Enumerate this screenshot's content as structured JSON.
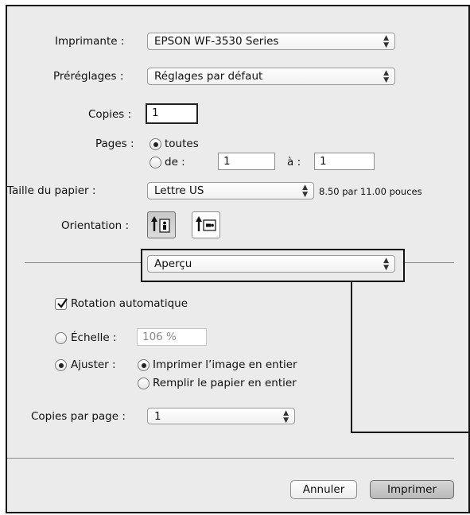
{
  "printer": {
    "label": "Imprimante :",
    "value": "EPSON WF-3530 Series"
  },
  "presets": {
    "label": "Préréglages :",
    "value": "Réglages par défaut"
  },
  "copies": {
    "label": "Copies :",
    "value": "1"
  },
  "pages": {
    "label": "Pages :",
    "all_label": "toutes",
    "from_label": "de :",
    "from_value": "1",
    "to_label": "à :",
    "to_value": "1"
  },
  "paper_size": {
    "label": "Taille du papier :",
    "value": "Lettre US",
    "dimensions": "8.50 par 11.00 pouces"
  },
  "orientation": {
    "label": "Orientation :"
  },
  "section_popup": {
    "value": "Aperçu"
  },
  "auto_rotate": {
    "label": "Rotation automatique"
  },
  "scale": {
    "label": "Échelle :",
    "value": "106 %"
  },
  "fit": {
    "label": "Ajuster :",
    "print_entire": "Imprimer l’image en entier",
    "fill_paper": "Remplir le papier en entier"
  },
  "copies_per_page": {
    "label": "Copies par page :",
    "value": "1"
  },
  "buttons": {
    "cancel": "Annuler",
    "print": "Imprimer"
  }
}
